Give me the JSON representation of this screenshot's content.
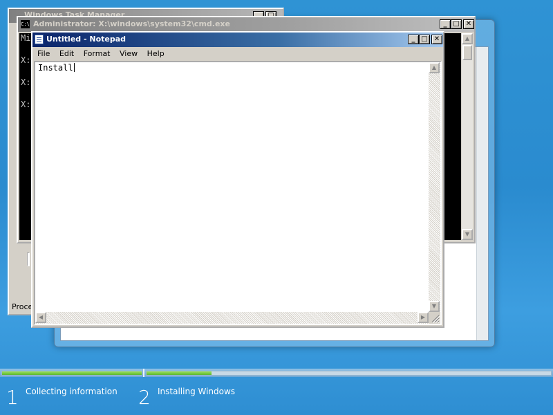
{
  "setup_window": {},
  "task_manager": {
    "title": "Windows Task Manager",
    "console_lines": [
      "Mi"
    ],
    "status": "Proces"
  },
  "cmd": {
    "title": "Administrator: X:\\windows\\system32\\cmd.exe",
    "icon_text": "C:\\",
    "lines": [
      "Mi",
      "",
      "X:",
      "",
      "X:",
      "",
      "X:"
    ]
  },
  "notepad": {
    "title": "Untitled - Notepad",
    "menu": [
      "File",
      "Edit",
      "Format",
      "View",
      "Help"
    ],
    "content": "Install"
  },
  "caption_buttons": {
    "minimize": "_",
    "maximize": "□",
    "close": "✕"
  },
  "progress": {
    "step1_fill": 1.0,
    "step2_fill": 0.16
  },
  "steps": [
    {
      "number": "1",
      "label": "Collecting information"
    },
    {
      "number": "2",
      "label": "Installing Windows"
    }
  ],
  "colors": {
    "desktop": "#2a8bcf",
    "progress_fill": "#5cb82c",
    "notepad_title": "#0a246a"
  }
}
